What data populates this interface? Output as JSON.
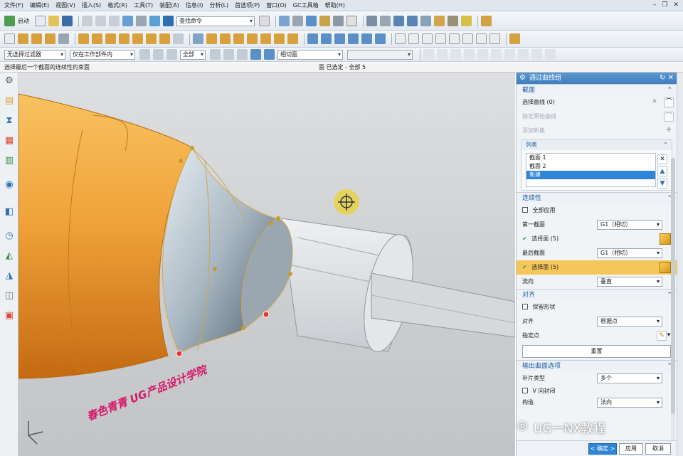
{
  "menu": [
    "文件(F)",
    "编辑(E)",
    "视图(V)",
    "插入(S)",
    "格式(R)",
    "工具(T)",
    "装配(A)",
    "信息(I)",
    "分析(L)",
    "首选项(P)",
    "窗口(O)",
    "GC工具箱",
    "帮助(H)"
  ],
  "toolbar": {
    "start_label": "启动",
    "search_placeholder": "查找命令",
    "filter_value": "无选择过滤器",
    "scope_value": "仅在工作部件内",
    "all_value": "全部",
    "face_value": "相切面"
  },
  "status": {
    "prompt": "选择最后一个截面的连续性约束面",
    "selection": "面 已选定 - 全部 5"
  },
  "panel": {
    "title": "通过曲线组",
    "section1": {
      "title": "截面",
      "select_curve": "选择曲线 (0)",
      "specify_origin": "指定原始曲线",
      "add_new_set": "添加新集",
      "list_title": "列表",
      "list_items": [
        "截面 1",
        "截面 2",
        "新建"
      ]
    },
    "section2": {
      "title": "连续性",
      "apply_all": "全部应用",
      "first_section": "第一截面",
      "first_value": "G1（相切）",
      "select_face_1": "选择面 (5)",
      "last_section": "最后截面",
      "last_value": "G1（相切）",
      "select_face_2": "选择面 (5)",
      "flow_dir": "流向",
      "flow_value": "垂直"
    },
    "section3": {
      "title": "对齐",
      "keep_shape": "保留形状",
      "align": "对齐",
      "align_value": "根据点",
      "specify_point": "指定点",
      "reset": "重置"
    },
    "section4": {
      "title": "输出曲面选项",
      "patch_type": "补片类型",
      "patch_value": "多个",
      "v_closed": "V 向封闭",
      "construct": "构造",
      "construct_value": "法向"
    },
    "buttons": {
      "ok": "< 确定 >",
      "apply": "应用",
      "cancel": "取消"
    }
  },
  "watermarks": {
    "school": "春色青青 UG产品设计学院",
    "wechat": "UG一NX教程"
  },
  "colors": {
    "title_bar": "#3f7fbf",
    "highlight": "#f5c65a",
    "model_orange": "#f0a23a",
    "selection_blue": "#2f86d6"
  }
}
